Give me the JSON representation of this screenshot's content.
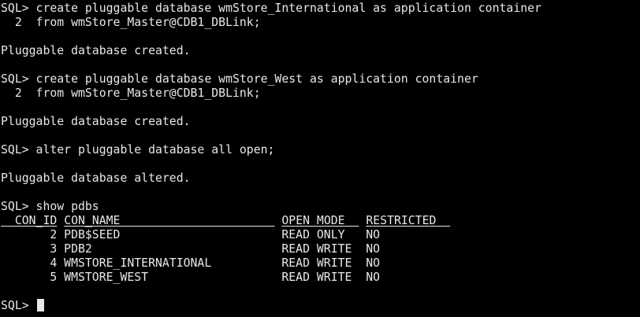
{
  "theme": {
    "background": "#000000",
    "foreground": "#e8e8e8"
  },
  "terminal": {
    "lines": [
      "SQL> create pluggable database wmStore_International as application container",
      "  2  from wmStore_Master@CDB1_DBLink;",
      "",
      "Pluggable database created.",
      "",
      "SQL> create pluggable database wmStore_West as application container",
      "  2  from wmStore_Master@CDB1_DBLink;",
      "",
      "Pluggable database created.",
      "",
      "SQL> alter pluggable database all open;",
      "",
      "Pluggable database altered.",
      "",
      "SQL> show pdbs"
    ],
    "table": {
      "headers": [
        "  CON_ID",
        "CON_NAME                      ",
        "OPEN MODE  ",
        "RESTRICTED  "
      ],
      "rows": [
        "       2 PDB$SEED                       READ ONLY   NO",
        "       3 PDB2                           READ WRITE  NO",
        "       4 WMSTORE_INTERNATIONAL          READ WRITE  NO",
        "       5 WMSTORE_WEST                   READ WRITE  NO"
      ]
    },
    "trailing_blank": "",
    "prompt": "SQL> "
  }
}
